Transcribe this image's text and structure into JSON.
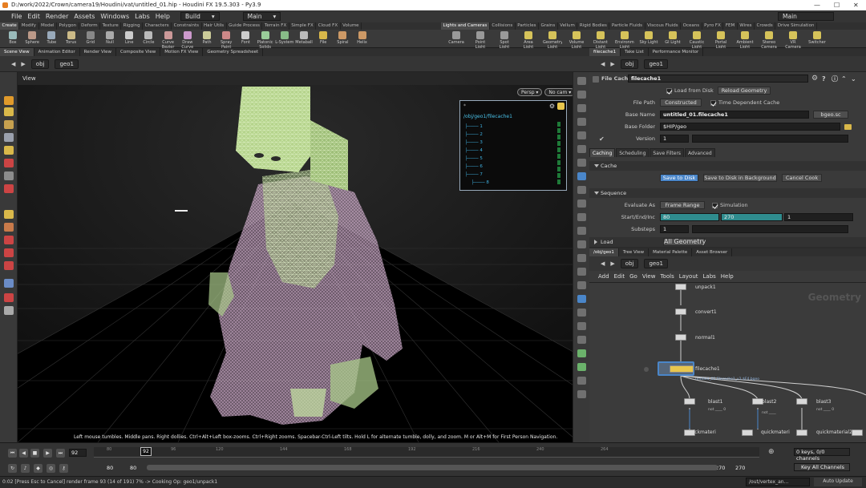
{
  "window": {
    "title": "D:/work/2022/Crown/camera19/Houdini/vat/untitled_01.hip - Houdini FX 19.5.303 - Py3.9",
    "controls": [
      "—",
      "☐",
      "✕"
    ]
  },
  "menubar": {
    "items": [
      "File",
      "Edit",
      "Render",
      "Assets",
      "Windows",
      "Labs",
      "Help"
    ],
    "build_label": "Build",
    "desktop_label": "Main",
    "right_desktop_label": "Main"
  },
  "shelf_tabs": {
    "left": [
      "Create",
      "Modify",
      "Model",
      "Polygon",
      "Deform",
      "Texture",
      "Rigging",
      "Characters",
      "Constraints",
      "Hair Utils",
      "Guide Process",
      "Terrain FX",
      "Simple FX",
      "Cloud FX",
      "Volume"
    ],
    "right": [
      "Lights and Cameras",
      "Collisions",
      "Particles",
      "Grains",
      "Vellum",
      "Rigid Bodies",
      "Particle Fluids",
      "Viscous Fluids",
      "Oceans",
      "Pyro FX",
      "FEM",
      "Wires",
      "Crowds",
      "Drive Simulation"
    ]
  },
  "shelf_tools": {
    "left": [
      "Box",
      "Sphere",
      "Tube",
      "Torus",
      "Grid",
      "Null",
      "Line",
      "Circle",
      "Curve Bezier",
      "Draw Curve",
      "Path",
      "Spray Paint",
      "Font",
      "Platonic Solids",
      "L-System",
      "Metaball",
      "File",
      "Spiral",
      "Helix"
    ],
    "right": [
      "Camera",
      "Point Light",
      "Spot Light",
      "Area Light",
      "Geometry Light",
      "Volume Light",
      "Distant Light",
      "Environment Light",
      "Sky Light",
      "GI Light",
      "Caustic Light",
      "Portal Light",
      "Ambient Light",
      "Stereo Camera",
      "VR Camera",
      "Switcher"
    ]
  },
  "pane_tabs": [
    "Scene View",
    "Animation Editor",
    "Render View",
    "Composite View",
    "Motion FX View",
    "Geometry Spreadsheet"
  ],
  "viewport": {
    "path_obj": "obj",
    "path_geo": "geo1",
    "label": "View",
    "persp": "Persp ▾",
    "cam": "No cam ▾",
    "hint": "Left mouse tumbles. Middle pans. Right dollies. Ctrl+Alt+Left box-zooms. Ctrl+Right zooms. Spacebar-Ctrl-Left tilts. Hold L for alternate tumble, dolly, and zoom.     M or Alt+M for First Person Navigation.",
    "inset": {
      "path": "/obj/geo1/filecache1",
      "items": [
        "1",
        "2",
        "3",
        "4",
        "5",
        "6",
        "7",
        "8"
      ]
    }
  },
  "param_pane": {
    "tabs": [
      "filecache1",
      "Take List",
      "Performance Monitor"
    ],
    "path_obj": "obj",
    "path_geo": "geo1",
    "node_type": "File Cache",
    "node_name": "filecache1",
    "load_from_disk": "Load from Disk",
    "reload_geometry": "Reload Geometry",
    "file_path_label": "File Path",
    "file_path_value": "Constructed",
    "time_dependent": "Time Dependent Cache",
    "base_name_label": "Base Name",
    "base_name_value": "untitled_01.filecache1",
    "ext_value": "bgeo.sc",
    "base_folder_label": "Base Folder",
    "base_folder_value": "$HIP/geo",
    "version_label": "Version",
    "version_value": "1",
    "tabs_inner": [
      "Caching",
      "Scheduling",
      "Save Filters",
      "Advanced"
    ],
    "cache_header": "Cache",
    "save_to_disk": "Save to Disk",
    "save_bg": "Save to Disk in Background",
    "cancel_cook": "Cancel Cook",
    "sequence_header": "Sequence",
    "evaluate_label": "Evaluate As",
    "evaluate_value": "Frame Range",
    "simulation": "Simulation",
    "start_label": "Start/End/Inc",
    "start_value": "80",
    "end_value": "270",
    "inc_value": "1",
    "substeps_label": "Substeps",
    "substeps_value": "1",
    "load_header": "Load",
    "load_value": "All Geometry"
  },
  "network": {
    "tabs": [
      "/obj/geo1",
      "Tree View",
      "Material Palette",
      "Asset Browser"
    ],
    "path_obj": "obj",
    "path_geo": "geo1",
    "menu": [
      "Add",
      "Edit",
      "Go",
      "View",
      "Tools",
      "Layout",
      "Labs",
      "Help"
    ],
    "context_label": "Geometry",
    "nodes": {
      "unpack": "unpack1",
      "convert": "convert1",
      "normal": "normal1",
      "filecache": "filecache1",
      "filecache_sub": "untitled_01.filecache1_v1.$F4.bgeo",
      "blast1": "blast1",
      "blast2": "blast2",
      "blast3": "blast3",
      "blast1_sub": "not ____ 0",
      "blast2_sub": "not ____",
      "blast3_sub": "not ____ 0",
      "qm": "quickmateri",
      "qm2": "quickmateri",
      "qm3": "quickmaterial2"
    }
  },
  "timeline": {
    "current_frame": "92",
    "ruler_marker": "92",
    "ticks": [
      "80",
      "96",
      "120",
      "144",
      "168",
      "192",
      "216",
      "240",
      "264"
    ],
    "range_start_a": "80",
    "range_start_b": "80",
    "range_end_a": "270",
    "range_end_b": "270",
    "keys": "0 keys, 0/0 channels",
    "key_all": "Key All Channels",
    "out_path": "/out/vertex_an...",
    "auto_update": "Auto Update"
  },
  "status": "0:02 [Press Esc to Cancel] render frame 93 (14 of 191) 7% -> Cooking Op: geo1/unpack1",
  "colors": {
    "accent_teal": "#2f8c8e",
    "node_yellow": "#e8c64d",
    "mesh_green": "#b6d48c",
    "mesh_pink": "#e7b8e2"
  }
}
